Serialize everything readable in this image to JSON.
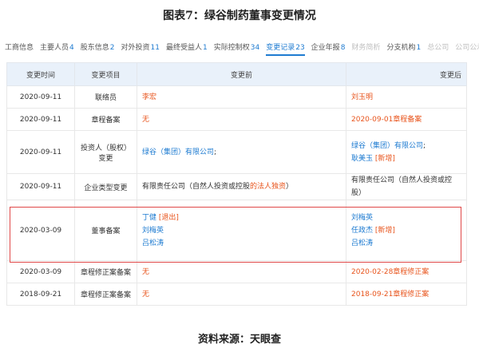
{
  "figure": {
    "title": "图表7：绿谷制药董事变更情况",
    "source": "资料来源：天眼查"
  },
  "tabs": [
    {
      "label": "工商信息",
      "count": "",
      "state": "normal"
    },
    {
      "label": "主要人员",
      "count": "4",
      "state": "normal"
    },
    {
      "label": "股东信息",
      "count": "2",
      "state": "normal"
    },
    {
      "label": "对外投资",
      "count": "11",
      "state": "normal"
    },
    {
      "label": "最终受益人",
      "count": "1",
      "state": "normal"
    },
    {
      "label": "实际控制权",
      "count": "34",
      "state": "normal"
    },
    {
      "label": "变更记录",
      "count": "23",
      "state": "active"
    },
    {
      "label": "企业年报",
      "count": "8",
      "state": "normal"
    },
    {
      "label": "财务简析",
      "count": "",
      "state": "disabled"
    },
    {
      "label": "分支机构",
      "count": "1",
      "state": "normal"
    },
    {
      "label": "总公司",
      "count": "",
      "state": "disabled"
    },
    {
      "label": "公司公示",
      "count": "",
      "state": "disabled"
    }
  ],
  "table": {
    "headers": {
      "time": "变更时间",
      "item": "变更项目",
      "before": "变更前",
      "after": "变更后"
    },
    "rows": [
      {
        "time": "2020-09-11",
        "item": "联络员",
        "before": [
          {
            "segments": [
              {
                "text": "李宏",
                "color": "red"
              }
            ]
          }
        ],
        "after": [
          {
            "segments": [
              {
                "text": "刘玉明",
                "color": "red"
              }
            ]
          }
        ]
      },
      {
        "time": "2020-09-11",
        "item": "章程备案",
        "before": [
          {
            "segments": [
              {
                "text": "无",
                "color": "red"
              }
            ]
          }
        ],
        "after": [
          {
            "segments": [
              {
                "text": "2020-09-01章程备案",
                "color": "red"
              }
            ]
          }
        ]
      },
      {
        "time": "2020-09-11",
        "item": "投资人（股权）\n变更",
        "before": [
          {
            "segments": [
              {
                "text": "绿谷（集团）有限公司",
                "color": "blue"
              },
              {
                "text": ";",
                "color": "dark"
              }
            ]
          }
        ],
        "after": [
          {
            "segments": [
              {
                "text": "绿谷（集团）有限公司",
                "color": "blue"
              },
              {
                "text": ";",
                "color": "dark"
              }
            ]
          },
          {
            "segments": [
              {
                "text": "耿美玉",
                "color": "blue"
              },
              {
                "text": " [新增]",
                "color": "red"
              }
            ]
          }
        ]
      },
      {
        "time": "2020-09-11",
        "item": "企业类型变更",
        "before": [
          {
            "segments": [
              {
                "text": "有限责任公司（自然人投资或控股",
                "color": "dark"
              },
              {
                "text": "的法人独资",
                "color": "red"
              },
              {
                "text": "）",
                "color": "dark"
              }
            ]
          }
        ],
        "after": [
          {
            "segments": [
              {
                "text": "有限责任公司（自然人投资或控股）",
                "color": "dark"
              }
            ]
          }
        ]
      },
      {
        "time": "2020-03-09",
        "item": "董事备案",
        "before": [
          {
            "segments": [
              {
                "text": "丁健",
                "color": "blue"
              },
              {
                "text": " [退出]",
                "color": "red"
              }
            ]
          },
          {
            "segments": [
              {
                "text": "刘梅英",
                "color": "blue"
              }
            ]
          },
          {
            "segments": [
              {
                "text": "吕松涛",
                "color": "blue"
              }
            ]
          }
        ],
        "after": [
          {
            "segments": [
              {
                "text": "刘梅英",
                "color": "blue"
              }
            ]
          },
          {
            "segments": [
              {
                "text": "任政杰",
                "color": "blue"
              },
              {
                "text": " [新增]",
                "color": "red"
              }
            ]
          },
          {
            "segments": [
              {
                "text": "吕松涛",
                "color": "blue"
              }
            ]
          }
        ]
      },
      {
        "time": "2020-03-09",
        "item": "章程修正案备案",
        "before": [
          {
            "segments": [
              {
                "text": "无",
                "color": "red"
              }
            ]
          }
        ],
        "after": [
          {
            "segments": [
              {
                "text": "2020-02-28章程修正案",
                "color": "red"
              }
            ]
          }
        ]
      },
      {
        "time": "2018-09-21",
        "item": "章程修正案备案",
        "before": [
          {
            "segments": [
              {
                "text": "无",
                "color": "red"
              }
            ]
          }
        ],
        "after": [
          {
            "segments": [
              {
                "text": "2018-09-21章程修正案",
                "color": "red"
              }
            ]
          }
        ]
      }
    ]
  },
  "highlight": {
    "row": 4,
    "color": "#e04848"
  },
  "colors": {
    "accent": "#1e7bd1",
    "red": "#e8541c",
    "header_bg": "#e9f1fa"
  }
}
